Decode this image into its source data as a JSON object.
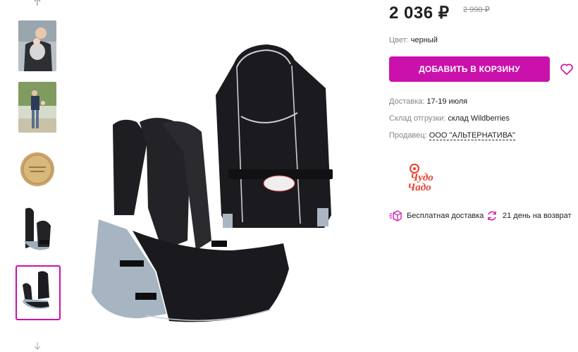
{
  "gallery": {
    "scroll_up_icon": "arrow-up-icon",
    "scroll_down_icon": "arrow-down-icon",
    "thumbnails": [
      "photo-1",
      "photo-2",
      "photo-3",
      "photo-4",
      "photo-5"
    ],
    "active_index": 4
  },
  "product": {
    "price": "2 036 ₽",
    "old_price": "2 990 ₽",
    "color_label": "Цвет:",
    "color_value": "черный",
    "add_to_cart": "ДОБАВИТЬ В КОРЗИНУ",
    "favorite_icon": "heart-icon"
  },
  "info": {
    "delivery_label": "Доставка:",
    "delivery_value": "17-19 июля",
    "warehouse_label": "Склад отгрузки:",
    "warehouse_value": "склад Wildberries",
    "seller_label": "Продавец:",
    "seller_value": "ООО \"АЛЬТЕРНАТИВА\""
  },
  "brand": {
    "logo_text_1": "Чудо",
    "logo_text_2": "Чадо"
  },
  "perks": {
    "free_delivery": "Бесплатная доставка",
    "return": "21 день на возврат"
  },
  "colors": {
    "accent": "#cb11ab",
    "brand_logo": "#e8412e"
  }
}
